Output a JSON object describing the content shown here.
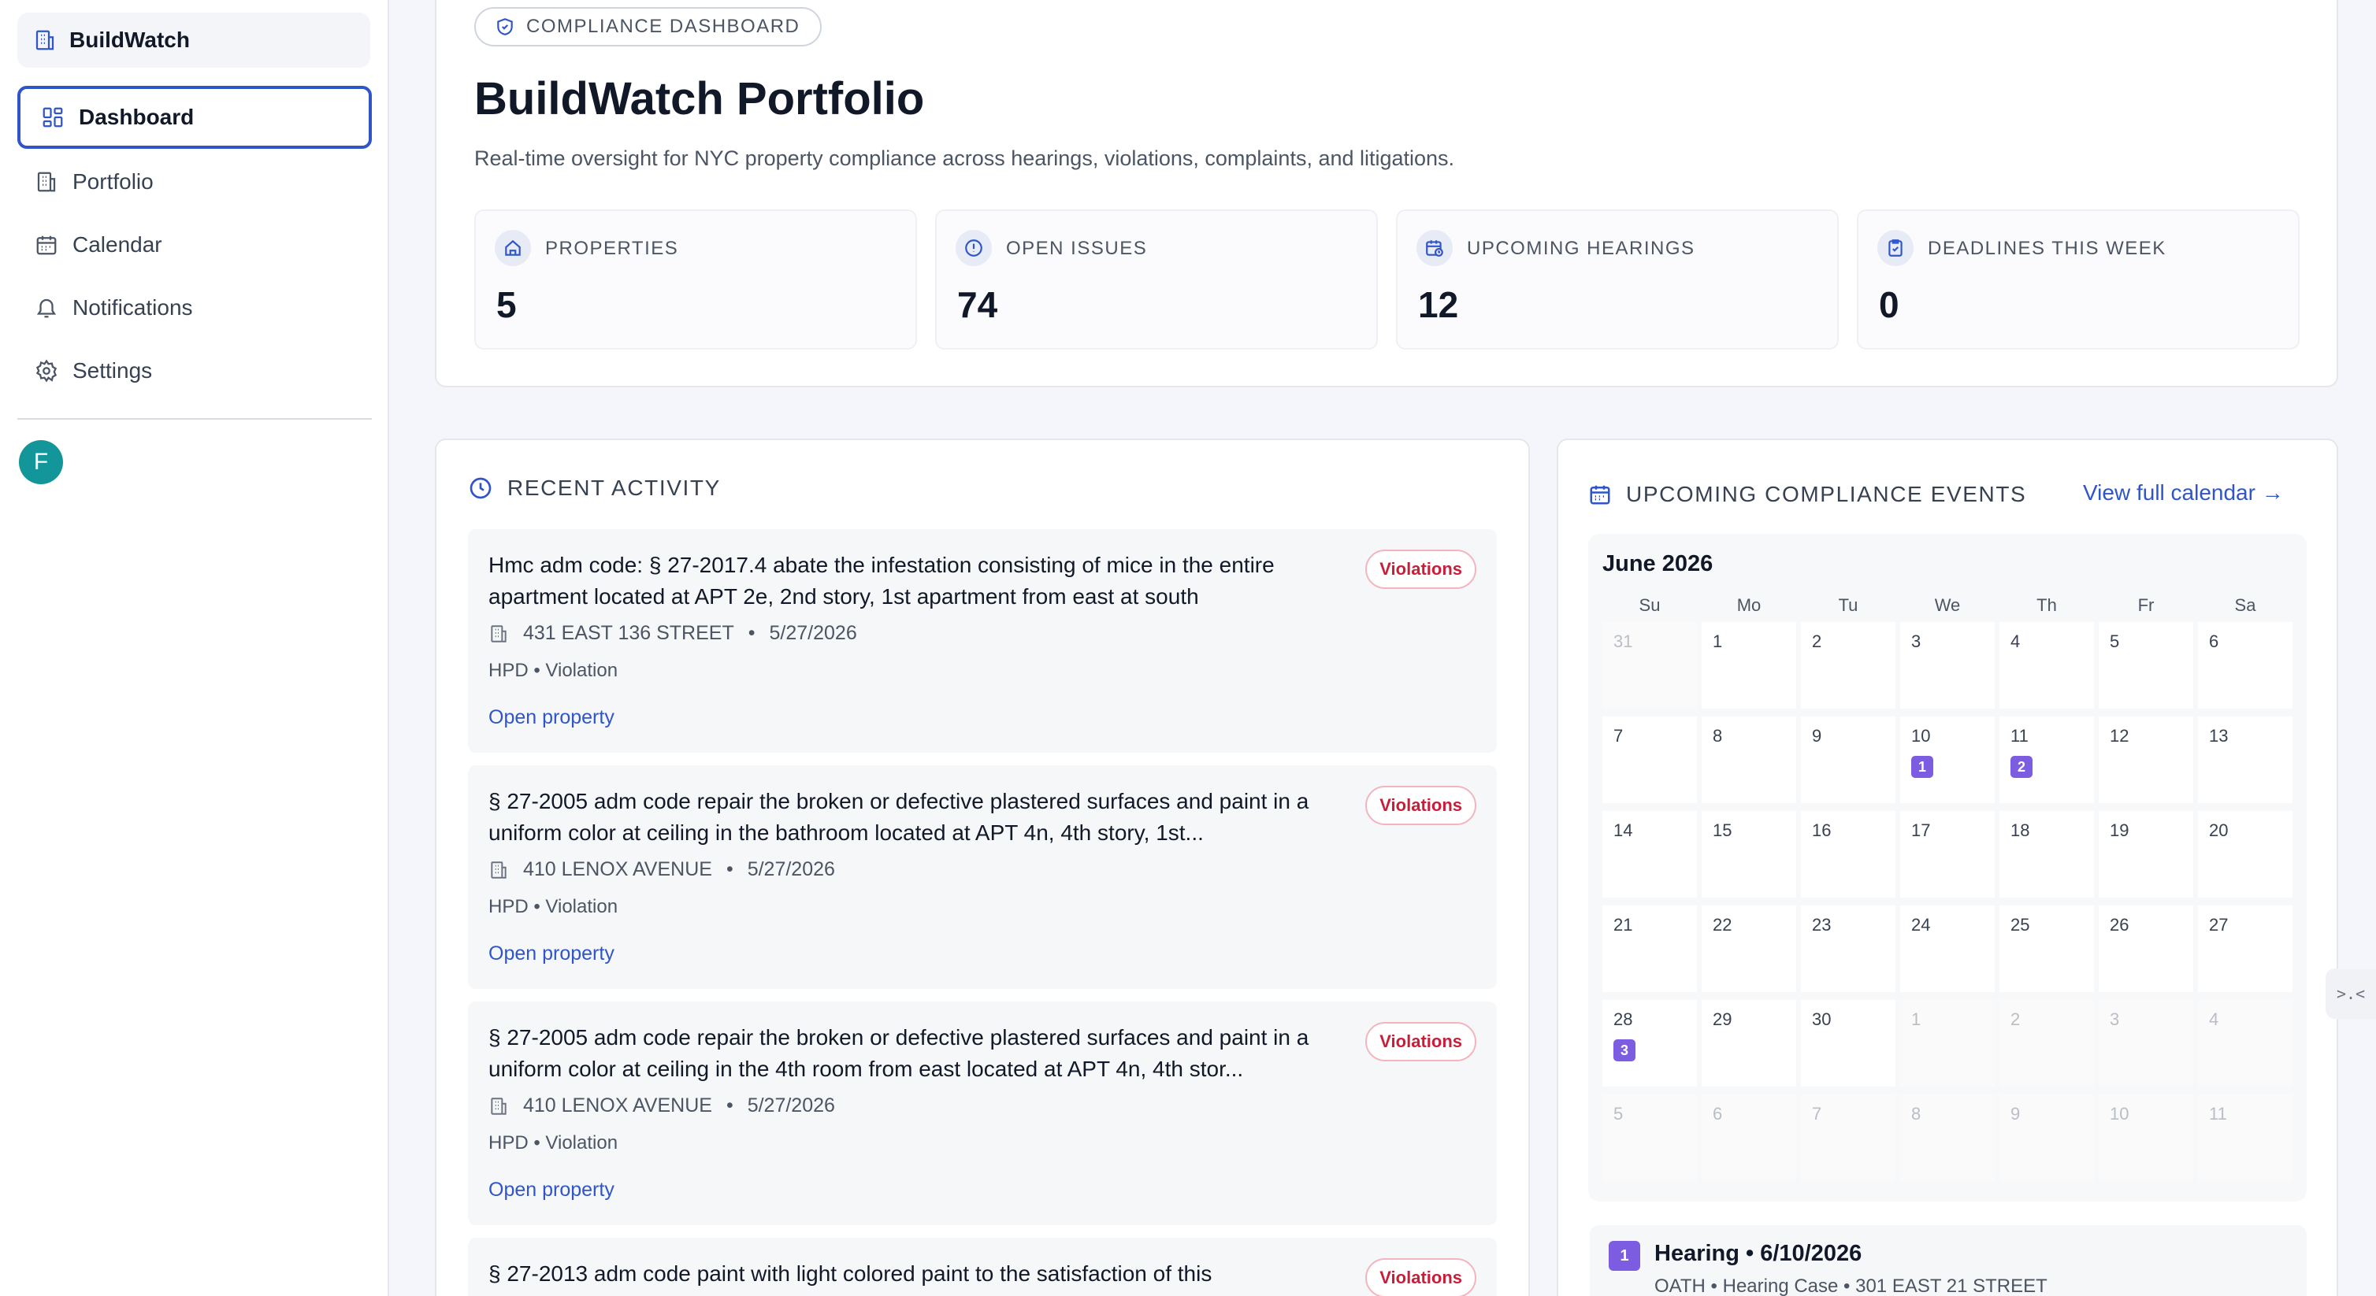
{
  "app": {
    "name": "BuildWatch"
  },
  "sidebar": {
    "items": [
      {
        "label": "Dashboard",
        "icon": "dashboard-icon",
        "active": true
      },
      {
        "label": "Portfolio",
        "icon": "building-icon"
      },
      {
        "label": "Calendar",
        "icon": "calendar-icon"
      },
      {
        "label": "Notifications",
        "icon": "bell-icon"
      },
      {
        "label": "Settings",
        "icon": "gear-icon"
      }
    ],
    "avatar_initial": "F"
  },
  "header": {
    "pill": "COMPLIANCE DASHBOARD",
    "title": "BuildWatch Portfolio",
    "subtitle": "Real-time oversight for NYC property compliance across hearings, violations, complaints, and litigations."
  },
  "stats": [
    {
      "label": "PROPERTIES",
      "value": "5",
      "icon": "home-icon"
    },
    {
      "label": "OPEN ISSUES",
      "value": "74",
      "icon": "alert-circle-icon"
    },
    {
      "label": "UPCOMING HEARINGS",
      "value": "12",
      "icon": "calendar-clock-icon"
    },
    {
      "label": "DEADLINES THIS WEEK",
      "value": "0",
      "icon": "clipboard-check-icon"
    }
  ],
  "activity": {
    "title": "RECENT ACTIVITY",
    "items": [
      {
        "title": "Hmc adm code: § 27-2017.4 abate the infestation consisting of mice in the entire apartment located at APT 2e, 2nd story, 1st apartment from east at south",
        "badge": "Violations",
        "address": "431 EAST 136 STREET",
        "date": "5/27/2026",
        "type": "HPD • Violation",
        "link": "Open property"
      },
      {
        "title": "§ 27-2005 adm code repair the broken or defective plastered surfaces and paint in a uniform color at ceiling in the bathroom located at APT 4n, 4th story, 1st...",
        "badge": "Violations",
        "address": "410 LENOX AVENUE",
        "date": "5/27/2026",
        "type": "HPD • Violation",
        "link": "Open property"
      },
      {
        "title": "§ 27-2005 adm code repair the broken or defective plastered surfaces and paint in a uniform color at ceiling in the 4th room from east located at APT 4n, 4th stor...",
        "badge": "Violations",
        "address": "410 LENOX AVENUE",
        "date": "5/27/2026",
        "type": "HPD • Violation",
        "link": "Open property"
      },
      {
        "title": "§ 27-2013 adm code paint with light colored paint to the satisfaction of this",
        "badge": "Violations",
        "address": "",
        "date": "",
        "type": "",
        "link": ""
      }
    ]
  },
  "events": {
    "title": "UPCOMING COMPLIANCE EVENTS",
    "view_link": "View full calendar →",
    "month": "June 2026",
    "weekdays": [
      "Su",
      "Mo",
      "Tu",
      "We",
      "Th",
      "Fr",
      "Sa"
    ],
    "weeks": [
      [
        {
          "d": "31",
          "o": true
        },
        {
          "d": "1"
        },
        {
          "d": "2"
        },
        {
          "d": "3"
        },
        {
          "d": "4"
        },
        {
          "d": "5"
        },
        {
          "d": "6"
        }
      ],
      [
        {
          "d": "7"
        },
        {
          "d": "8"
        },
        {
          "d": "9"
        },
        {
          "d": "10",
          "e": "1"
        },
        {
          "d": "11",
          "e": "2"
        },
        {
          "d": "12"
        },
        {
          "d": "13"
        }
      ],
      [
        {
          "d": "14"
        },
        {
          "d": "15"
        },
        {
          "d": "16"
        },
        {
          "d": "17"
        },
        {
          "d": "18"
        },
        {
          "d": "19"
        },
        {
          "d": "20"
        }
      ],
      [
        {
          "d": "21"
        },
        {
          "d": "22"
        },
        {
          "d": "23"
        },
        {
          "d": "24"
        },
        {
          "d": "25"
        },
        {
          "d": "26"
        },
        {
          "d": "27"
        }
      ],
      [
        {
          "d": "28",
          "e": "3"
        },
        {
          "d": "29"
        },
        {
          "d": "30"
        },
        {
          "d": "1",
          "o": true
        },
        {
          "d": "2",
          "o": true
        },
        {
          "d": "3",
          "o": true
        },
        {
          "d": "4",
          "o": true
        }
      ],
      [
        {
          "d": "5",
          "o": true
        },
        {
          "d": "6",
          "o": true
        },
        {
          "d": "7",
          "o": true
        },
        {
          "d": "8",
          "o": true
        },
        {
          "d": "9",
          "o": true
        },
        {
          "d": "10",
          "o": true
        },
        {
          "d": "11",
          "o": true
        }
      ]
    ],
    "list": [
      {
        "num": "1",
        "title": "Hearing • 6/10/2026",
        "sub": "OATH • Hearing Case • 301 EAST 21 STREET"
      }
    ]
  },
  "collapse_label": ">.<",
  "colors": {
    "accent": "#2f55c9",
    "event": "#7c5ce0",
    "badge": "#c81e3a",
    "avatar": "#12969a"
  }
}
